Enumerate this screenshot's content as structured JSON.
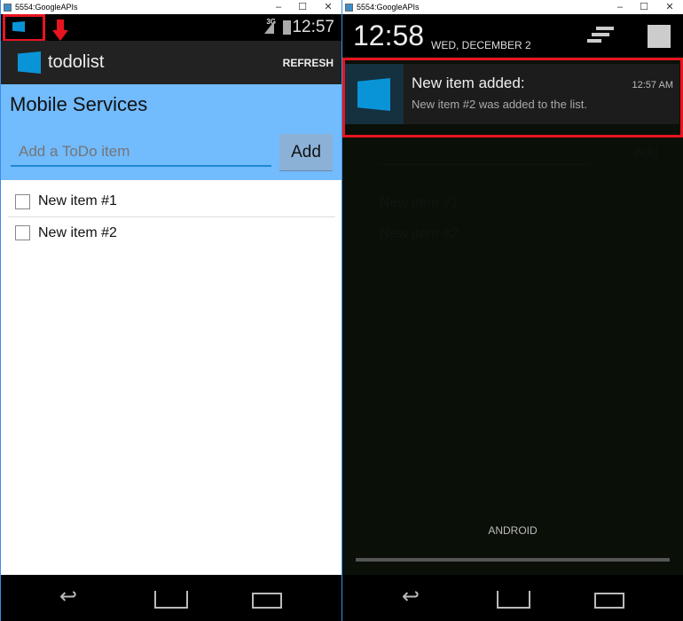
{
  "left_window": {
    "title": "5554:GoogleAPIs",
    "status": {
      "network": "3G",
      "time": "12:57"
    },
    "action_bar": {
      "app_name": "todolist",
      "refresh_label": "REFRESH"
    },
    "header": {
      "title": "Mobile Services"
    },
    "input": {
      "placeholder": "Add a ToDo item",
      "value": ""
    },
    "add_label": "Add",
    "items": [
      {
        "label": "New item #1",
        "checked": false
      },
      {
        "label": "New item #2",
        "checked": false
      }
    ]
  },
  "right_window": {
    "title": "5554:GoogleAPIs",
    "shade": {
      "time": "12:58",
      "date": "WED, DECEMBER 2"
    },
    "notification": {
      "title": "New item added:",
      "text": "New item #2 was added to the list.",
      "time": "12:57 AM"
    },
    "background": {
      "add_label": "Add",
      "items": [
        "New item #1",
        "New item #2"
      ]
    },
    "carrier": "ANDROID"
  },
  "colors": {
    "accent": "#72bbfd",
    "highlight": "#e8141f",
    "logo": "#0a94d8"
  }
}
